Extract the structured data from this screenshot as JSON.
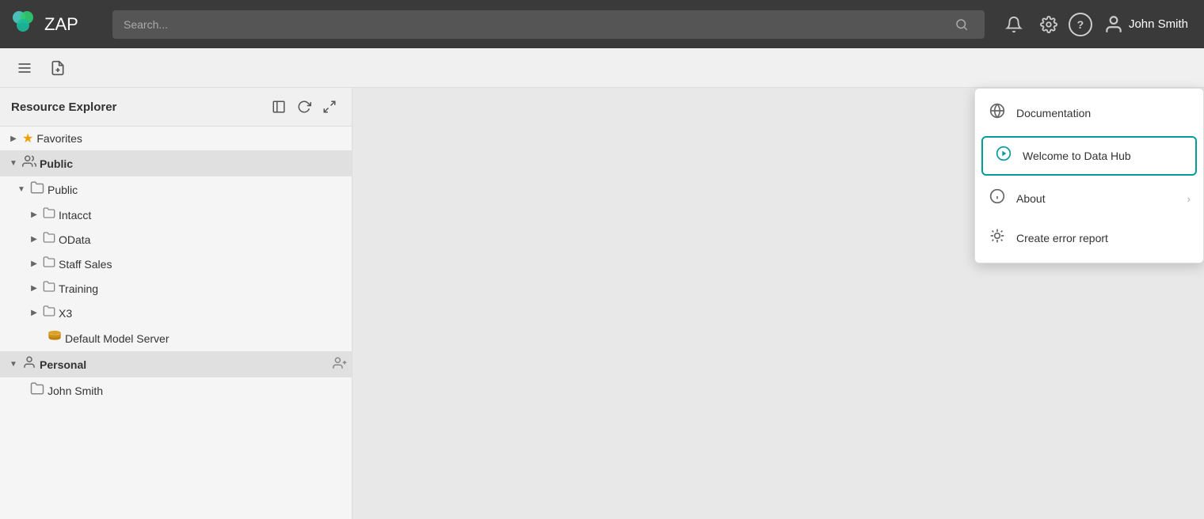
{
  "app": {
    "title": "ZAP",
    "logo_text": "ZAP"
  },
  "topnav": {
    "search_placeholder": "Search...",
    "user_name": "John Smith",
    "icons": {
      "bell": "🔔",
      "settings": "⚙",
      "help": "?"
    }
  },
  "toolbar": {
    "menu_icon": "☰",
    "new_doc_icon": "📄"
  },
  "sidebar": {
    "title": "Resource Explorer",
    "header_icons": [
      "⬜",
      "↺",
      "⤢"
    ],
    "sections": [
      {
        "id": "favorites",
        "label": "Favorites",
        "icon": "★",
        "arrow": "▶",
        "indent": 0,
        "type": "section"
      },
      {
        "id": "public-header",
        "label": "Public",
        "icon": "👥",
        "arrow": "▼",
        "indent": 0,
        "type": "section"
      },
      {
        "id": "public-folder",
        "label": "Public",
        "icon": "🗁",
        "arrow": "▼",
        "indent": 1
      },
      {
        "id": "intacct",
        "label": "Intacct",
        "icon": "🗁",
        "arrow": "▶",
        "indent": 2
      },
      {
        "id": "odata",
        "label": "OData",
        "icon": "🗁",
        "arrow": "▶",
        "indent": 2
      },
      {
        "id": "staff-sales",
        "label": "Staff Sales",
        "icon": "🗁",
        "arrow": "▶",
        "indent": 2
      },
      {
        "id": "training",
        "label": "Training",
        "icon": "🗁",
        "arrow": "▶",
        "indent": 2
      },
      {
        "id": "x3",
        "label": "X3",
        "icon": "🗁",
        "arrow": "▶",
        "indent": 2
      },
      {
        "id": "default-model-server",
        "label": "Default Model Server",
        "icon": "stack",
        "arrow": "",
        "indent": 2
      },
      {
        "id": "personal-header",
        "label": "Personal",
        "icon": "👤",
        "arrow": "▼",
        "indent": 0,
        "type": "section",
        "has_add": true
      },
      {
        "id": "john-smith-folder",
        "label": "John Smith",
        "icon": "🗁",
        "arrow": "",
        "indent": 1
      }
    ]
  },
  "dropdown": {
    "items": [
      {
        "id": "documentation",
        "label": "Documentation",
        "icon": "globe",
        "active": false,
        "has_arrow": false
      },
      {
        "id": "welcome-to-data-hub",
        "label": "Welcome to Data Hub",
        "icon": "play",
        "active": true,
        "has_arrow": false
      },
      {
        "id": "about",
        "label": "About",
        "icon": "info",
        "active": false,
        "has_arrow": true
      },
      {
        "id": "create-error-report",
        "label": "Create error report",
        "icon": "bug",
        "active": false,
        "has_arrow": false
      }
    ]
  }
}
